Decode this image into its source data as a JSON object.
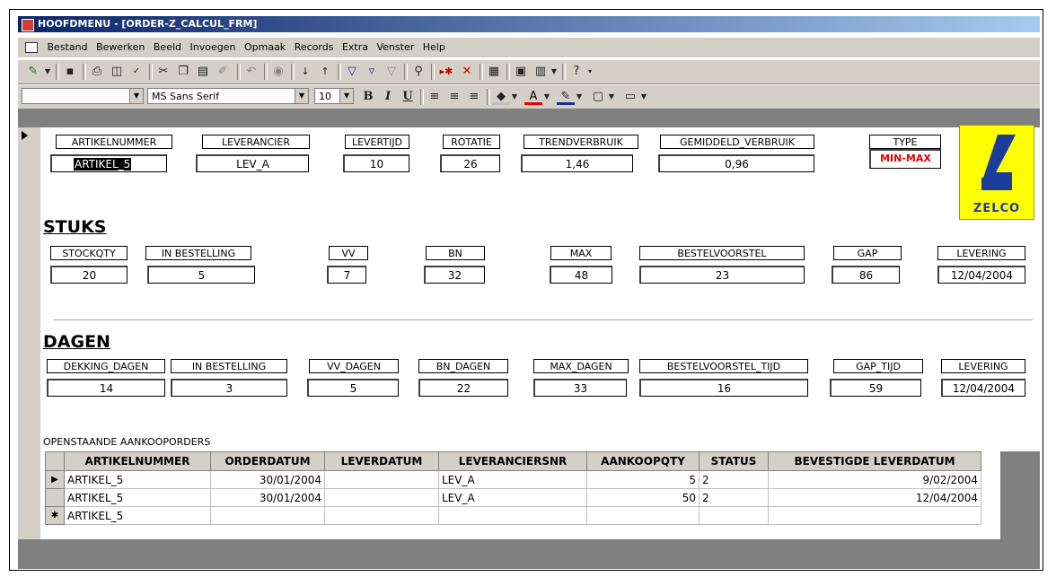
{
  "window": {
    "title": "HOOFDMENU - [ORDER-Z_CALCUL_FRM]"
  },
  "menu": [
    "Bestand",
    "Bewerken",
    "Beeld",
    "Invoegen",
    "Opmaak",
    "Records",
    "Extra",
    "Venster",
    "Help"
  ],
  "toolbar2": {
    "object_combo": "",
    "font": "MS Sans Serif",
    "size": "10"
  },
  "header": {
    "artikelnummer": {
      "label": "ARTIKELNUMMER",
      "value": "ARTIKEL_5"
    },
    "leverancier": {
      "label": "LEVERANCIER",
      "value": "LEV_A"
    },
    "levertijd": {
      "label": "LEVERTIJD",
      "value": "10"
    },
    "rotatie": {
      "label": "ROTATIE",
      "value": "26"
    },
    "trendverbruik": {
      "label": "TRENDVERBRUIK",
      "value": "1,46"
    },
    "gemiddeld_verbruik": {
      "label": "GEMIDDELD_VERBRUIK",
      "value": "0,96"
    },
    "type": {
      "label": "TYPE",
      "value": "MIN-MAX"
    }
  },
  "logo": {
    "text": "ZELCO"
  },
  "stuks": {
    "heading": "STUKS",
    "fields": [
      {
        "label": "STOCKQTY",
        "value": "20"
      },
      {
        "label": "IN BESTELLING",
        "value": "5"
      },
      {
        "label": "VV",
        "value": "7"
      },
      {
        "label": "BN",
        "value": "32"
      },
      {
        "label": "MAX",
        "value": "48"
      },
      {
        "label": "BESTELVOORSTEL",
        "value": "23"
      },
      {
        "label": "GAP",
        "value": "86"
      },
      {
        "label": "LEVERING",
        "value": "12/04/2004"
      }
    ]
  },
  "dagen": {
    "heading": "DAGEN",
    "fields": [
      {
        "label": "DEKKING_DAGEN",
        "value": "14"
      },
      {
        "label": "IN BESTELLING",
        "value": "3"
      },
      {
        "label": "VV_DAGEN",
        "value": "5"
      },
      {
        "label": "BN_DAGEN",
        "value": "22"
      },
      {
        "label": "MAX_DAGEN",
        "value": "33"
      },
      {
        "label": "BESTELVOORSTEL_TIJD",
        "value": "16"
      },
      {
        "label": "GAP_TIJD",
        "value": "59"
      },
      {
        "label": "LEVERING",
        "value": "12/04/2004"
      }
    ]
  },
  "orders": {
    "title": "OPENSTAANDE AANKOOPORDERS",
    "columns": [
      "ARTIKELNUMMER",
      "ORDERDATUM",
      "LEVERDATUM",
      "LEVERANCIERSNR",
      "AANKOOPQTY",
      "STATUS",
      "BEVESTIGDE LEVERDATUM"
    ],
    "rows": [
      {
        "marker": "▶",
        "artikel": "ARTIKEL_5",
        "orderdatum": "30/01/2004",
        "leverdatum": "",
        "leverancier": "LEV_A",
        "qty": "5",
        "status": "2",
        "bevestigd": "9/02/2004"
      },
      {
        "marker": "",
        "artikel": "ARTIKEL_5",
        "orderdatum": "30/01/2004",
        "leverdatum": "",
        "leverancier": "LEV_A",
        "qty": "50",
        "status": "2",
        "bevestigd": "12/04/2004"
      },
      {
        "marker": "✱",
        "artikel": "ARTIKEL_5",
        "orderdatum": "",
        "leverdatum": "",
        "leverancier": "",
        "qty": "",
        "status": "",
        "bevestigd": ""
      }
    ]
  }
}
